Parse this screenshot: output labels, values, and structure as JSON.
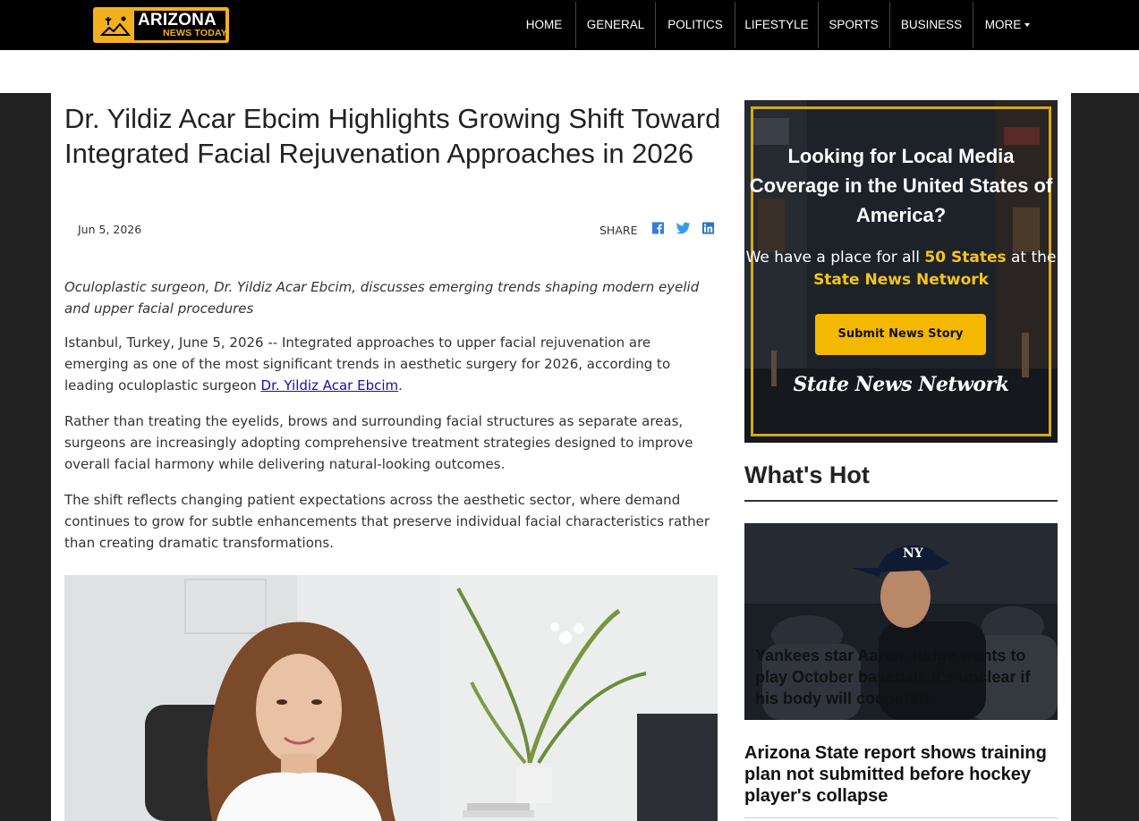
{
  "site": {
    "logo_name": "ARIZONA",
    "logo_sub": "NEWS TODAY",
    "brand_color": "#f2b01e"
  },
  "nav": {
    "items": [
      "HOME",
      "GENERAL",
      "POLITICS",
      "LIFESTYLE",
      "SPORTS",
      "BUSINESS",
      "MORE"
    ]
  },
  "article": {
    "title": "Dr. Yildiz Acar Ebcim Highlights Growing Shift Toward Integrated Facial Rejuvenation Approaches in 2026",
    "date": "Jun 5, 2026",
    "share_label": "SHARE",
    "share_icons": [
      "facebook-icon",
      "twitter-icon",
      "linkedin-icon"
    ],
    "lede": "Oculoplastic surgeon, Dr. Yildiz Acar Ebcim, discusses emerging trends shaping modern eyelid and upper facial procedures",
    "p1_before": "Istanbul, Turkey, June 5, 2026 -- Integrated approaches to upper facial rejuvenation are emerging as one of the most significant trends in aesthetic surgery for 2026, according to leading oculoplastic surgeon ",
    "p1_link": "Dr. Yildiz Acar Ebcim",
    "p1_after": ".",
    "p2": "Rather than treating the eyelids, brows and surrounding facial structures as separate areas, surgeons are increasingly adopting comprehensive treatment strategies designed to improve overall facial harmony while delivering natural-looking outcomes.",
    "p3": "The shift reflects changing patient expectations across the aesthetic sector, where demand continues to grow for subtle enhancements that preserve individual facial characteristics rather than creating dramatic transformations."
  },
  "ad": {
    "title": "Looking for Local Media Coverage in the United States of America?",
    "text_1": "We have a place for all ",
    "text_hl1": "50 States",
    "text_2": " at the ",
    "text_hl2": "State News Network",
    "button": "Submit News Story",
    "brand": "State News Network",
    "accent_color": "#f5c518"
  },
  "hot": {
    "heading": "What's Hot",
    "featured_caption": "Yankees star Aaron Judge wants to play October baseball. It's unclear if his body will cooperate",
    "story_2": "Arizona State report shows training plan not submitted before hockey player's collapse"
  }
}
